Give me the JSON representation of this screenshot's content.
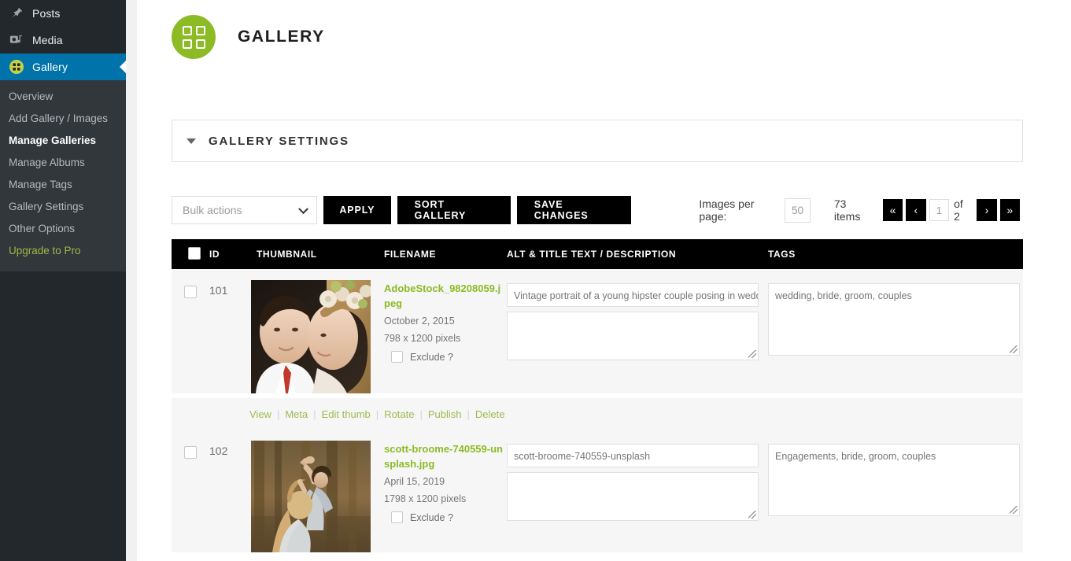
{
  "sidebar": {
    "top_items": [
      {
        "label": "Posts",
        "icon": "pin-icon",
        "active": false
      },
      {
        "label": "Media",
        "icon": "media-icon",
        "active": false
      },
      {
        "label": "Gallery",
        "icon": "gallery-grid-icon",
        "active": true
      }
    ],
    "submenu": [
      {
        "label": "Overview",
        "current": false,
        "pro": false
      },
      {
        "label": "Add Gallery / Images",
        "current": false,
        "pro": false
      },
      {
        "label": "Manage Galleries",
        "current": true,
        "pro": false
      },
      {
        "label": "Manage Albums",
        "current": false,
        "pro": false
      },
      {
        "label": "Manage Tags",
        "current": false,
        "pro": false
      },
      {
        "label": "Gallery Settings",
        "current": false,
        "pro": false
      },
      {
        "label": "Other Options",
        "current": false,
        "pro": false
      },
      {
        "label": "Upgrade to Pro",
        "current": false,
        "pro": true
      }
    ],
    "active_color": "#0073aa",
    "background": "#23282d",
    "submenu_background": "#32373c",
    "pro_color": "#a3b745"
  },
  "header": {
    "title": "GALLERY",
    "logo_icon": "gallery-grid-icon",
    "logo_color": "#8cbb26"
  },
  "settings_panel": {
    "title": "GALLERY SETTINGS",
    "caret_icon": "caret-down-icon"
  },
  "toolbar": {
    "bulk_actions_value": "Bulk actions",
    "bulk_actions_chevron": "chevron-down-icon",
    "apply_label": "APPLY",
    "sort_gallery_label": "SORT GALLERY",
    "save_changes_label": "SAVE CHANGES"
  },
  "pagination": {
    "images_per_page_label": "Images per page:",
    "images_per_page_value": "50",
    "items_count": "73 items",
    "first_icon": "«",
    "prev_icon": "‹",
    "current_page": "1",
    "of_label": "of 2",
    "next_icon": "›",
    "last_icon": "»"
  },
  "table": {
    "columns": [
      {
        "key": "check",
        "label": ""
      },
      {
        "key": "id",
        "label": "ID"
      },
      {
        "key": "thumbnail",
        "label": "THUMBNAIL"
      },
      {
        "key": "filename",
        "label": "FILENAME"
      },
      {
        "key": "alt",
        "label": "ALT & TITLE TEXT / DESCRIPTION"
      },
      {
        "key": "tags",
        "label": "TAGS"
      }
    ],
    "exclude_label": "Exclude ?",
    "row_actions": [
      "View",
      "Meta",
      "Edit thumb",
      "Rotate",
      "Publish",
      "Delete"
    ],
    "rows": [
      {
        "id": "101",
        "filename": "AdobeStock_98208059.jpeg",
        "date": "October 2, 2015",
        "dimensions": "798 x 1200 pixels",
        "alt_text": "Vintage portrait of a young hipster couple posing  in weddin",
        "description": "",
        "tags": "wedding, bride, groom, couples",
        "thumb_name": "wedding-couple-thumbnail"
      },
      {
        "id": "102",
        "filename": "scott-broome-740559-unsplash.jpg",
        "date": "April 15, 2019",
        "dimensions": "1798 x 1200 pixels",
        "alt_text": "scott-broome-740559-unsplash",
        "description": "",
        "tags": "Engagements, bride, groom, couples",
        "thumb_name": "dancing-couple-forest-thumbnail"
      }
    ]
  }
}
